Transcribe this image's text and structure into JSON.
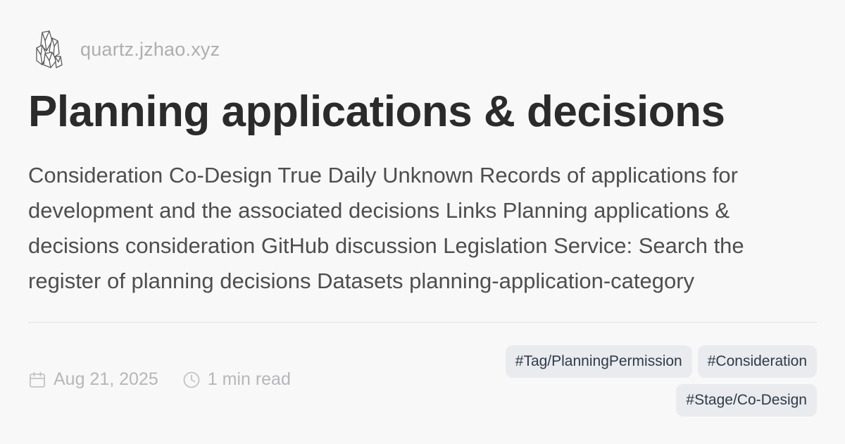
{
  "site": {
    "logo_icon": "crystal-cluster-logo-icon",
    "url": "quartz.jzhao.xyz"
  },
  "page": {
    "title": "Planning applications & decisions",
    "description": "Consideration Co-Design True Daily Unknown Records of applications for development and the associated decisions Links Planning applications & decisions consideration GitHub discussion Legislation Service: Search the register of planning decisions Datasets planning-application-category"
  },
  "meta": {
    "date_icon": "calendar-icon",
    "date": "Aug 21, 2025",
    "read_icon": "clock-icon",
    "reading_time": "1 min read"
  },
  "tags": [
    "#Tag/PlanningPermission",
    "#Consideration",
    "#Stage/Co-Design"
  ],
  "colors": {
    "background": "#f8f8f9",
    "title": "#2b2b2b",
    "description": "#4e4e4e",
    "muted": "#aeaeae",
    "tag_background": "#e9ebee",
    "tag_text": "#2f3b4a"
  }
}
